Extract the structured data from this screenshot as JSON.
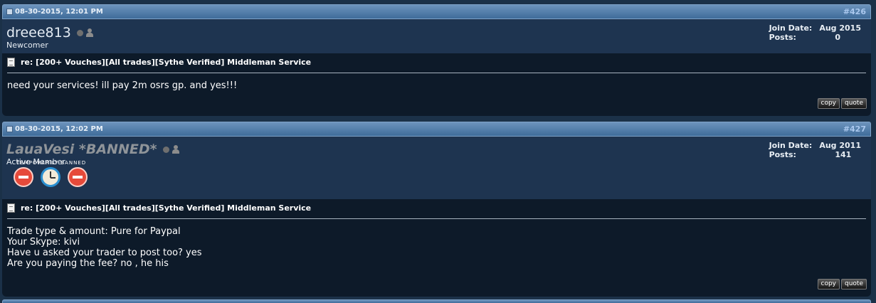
{
  "posts": [
    {
      "date": "08-30-2015, 12:01 PM",
      "number": "#426",
      "username": "dreee813",
      "user_title": "Newcomer",
      "join_date_label": "Join Date:",
      "join_date": "Aug 2015",
      "posts_label": "Posts:",
      "post_count": "0",
      "thread_title": "re: [200+ Vouches][All trades][Sythe Verified] Middleman Service",
      "message_lines": [
        "need your services! ill pay 2m osrs gp. and yes!!!"
      ],
      "copy_label": "copy",
      "quote_label": "quote"
    },
    {
      "date": "08-30-2015, 12:02 PM",
      "number": "#427",
      "username": "LauaVesi *BANNED*",
      "user_title": "Active Member",
      "badge_caption": "TEMPORARILY BANNED",
      "join_date_label": "Join Date:",
      "join_date": "Aug 2011",
      "posts_label": "Posts:",
      "post_count": "141",
      "thread_title": "re: [200+ Vouches][All trades][Sythe Verified] Middleman Service",
      "message_lines": [
        "Trade type & amount: Pure for Paypal",
        "Your Skype: kivi",
        "Have u asked your trader to post too? yes",
        "Are you paying the fee? no , he his"
      ],
      "copy_label": "copy",
      "quote_label": "quote"
    }
  ]
}
